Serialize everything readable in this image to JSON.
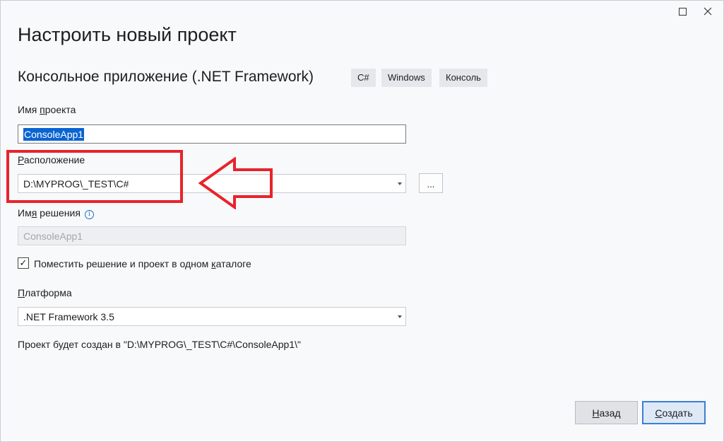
{
  "title": "Настроить новый проект",
  "subtitle": "Консольное приложение (.NET Framework)",
  "tags": [
    "C#",
    "Windows",
    "Консоль"
  ],
  "project_name": {
    "label_prefix": "Имя ",
    "label_underlined": "п",
    "label_suffix": "роекта",
    "value": "ConsoleApp1"
  },
  "location": {
    "label_underlined": "Р",
    "label_suffix": "асположение",
    "value": "D:\\MYPROG\\_TEST\\C#",
    "browse_label": "..."
  },
  "solution_name": {
    "label_prefix": "Им",
    "label_underlined": "я",
    "label_suffix": " решения",
    "value": "ConsoleApp1"
  },
  "same_dir": {
    "checked": true,
    "check_glyph": "✓",
    "label_prefix": "Поместить решение и проект в одном ",
    "label_underlined": "к",
    "label_suffix": "аталоге"
  },
  "platform": {
    "label_underlined": "П",
    "label_suffix": "латформа",
    "value": ".NET Framework 3.5"
  },
  "result_path": "Проект будет создан в \"D:\\MYPROG\\_TEST\\C#\\ConsoleApp1\\\"",
  "buttons": {
    "back_underlined": "Н",
    "back_suffix": "азад",
    "create_underlined": "С",
    "create_suffix": "оздать"
  },
  "colors": {
    "annotation": "#e8232b",
    "accent": "#3c7fd1",
    "selection": "#0a64d2"
  }
}
